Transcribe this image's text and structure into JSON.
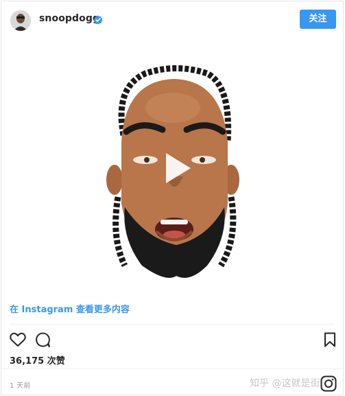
{
  "header": {
    "username": "snoopdogg",
    "verified_icon": "verified-badge-icon",
    "follow_label": "关注"
  },
  "media": {
    "type": "video",
    "play_icon": "play-icon"
  },
  "caption": {
    "view_more": "在 Instagram 查看更多内容"
  },
  "actions": {
    "like_icon": "heart-icon",
    "comment_icon": "comment-icon",
    "save_icon": "bookmark-icon"
  },
  "likes_text": "36,175 次赞",
  "timestamp": "1 天前",
  "watermark": "知乎 @这就是街",
  "colors": {
    "accent": "#3897f0",
    "text": "#262626",
    "muted": "#999999",
    "border": "#efefef"
  }
}
